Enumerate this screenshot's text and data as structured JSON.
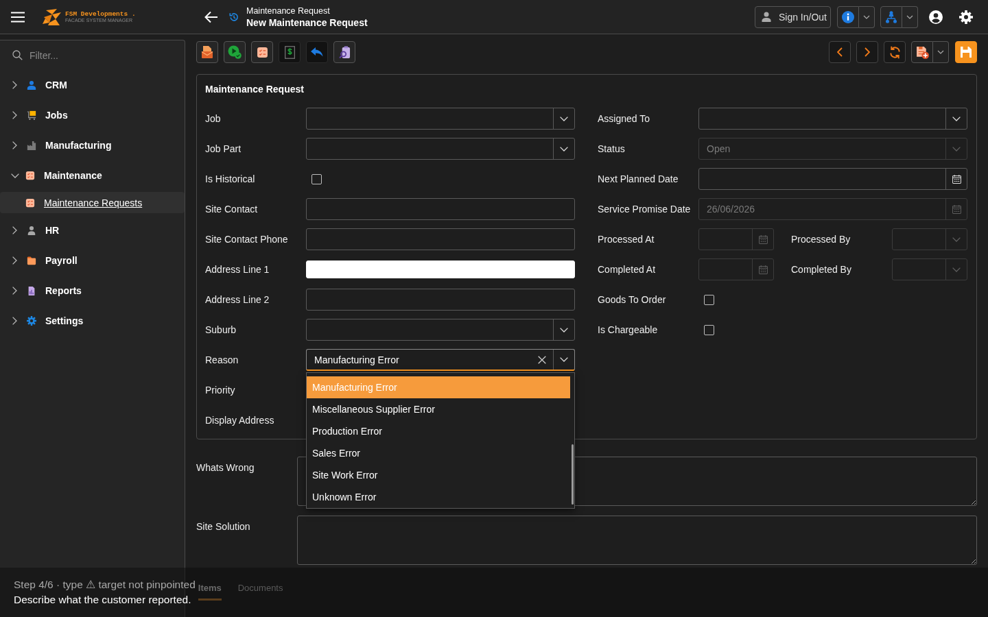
{
  "app_bar": {
    "logo_name": "FSM Developments .",
    "logo_tagline": "FACADE SYSTEM MANAGER",
    "breadcrumb": "Maintenance Request",
    "title": "New Maintenance Request",
    "sign_in_button": "Sign In/Out"
  },
  "sidebar": {
    "filter_placeholder": "Filter...",
    "items": [
      {
        "label": "CRM",
        "expanded": false
      },
      {
        "label": "Jobs",
        "expanded": false
      },
      {
        "label": "Manufacturing",
        "expanded": false
      },
      {
        "label": "Maintenance",
        "expanded": true,
        "children": [
          {
            "label": "Maintenance Requests",
            "selected": true
          }
        ]
      },
      {
        "label": "HR",
        "expanded": false
      },
      {
        "label": "Payroll",
        "expanded": false
      },
      {
        "label": "Reports",
        "expanded": false
      },
      {
        "label": "Settings",
        "expanded": false
      }
    ]
  },
  "form": {
    "title": "Maintenance Request",
    "left_fields": [
      {
        "label": "Job",
        "kind": "select",
        "disabled": false,
        "open": false
      },
      {
        "label": "Job Part",
        "kind": "select",
        "disabled": false,
        "open": false
      },
      {
        "label": "Is Historical",
        "kind": "checkbox",
        "checked": false
      },
      {
        "label": "Site Contact",
        "kind": "text",
        "disabled": false,
        "autofilled": false
      },
      {
        "label": "Site Contact Phone",
        "kind": "text",
        "disabled": false,
        "autofilled": false
      },
      {
        "label": "Address Line 1",
        "kind": "text",
        "disabled": false,
        "autofilled": true
      },
      {
        "label": "Address Line 2",
        "kind": "text",
        "disabled": false,
        "autofilled": false
      },
      {
        "label": "Suburb",
        "kind": "select",
        "disabled": false,
        "open": false
      },
      {
        "label": "Reason",
        "kind": "select",
        "disabled": false,
        "open": true,
        "value": "Manufacturing Error",
        "options": [
          {
            "label": "Manufacturing Error",
            "selected": true
          },
          {
            "label": "Miscellaneous Supplier Error",
            "selected": false
          },
          {
            "label": "Production Error",
            "selected": false
          },
          {
            "label": "Sales Error",
            "selected": false
          },
          {
            "label": "Site Work Error",
            "selected": false
          },
          {
            "label": "Unknown Error",
            "selected": false
          }
        ]
      },
      {
        "label": "Priority",
        "kind": "label"
      },
      {
        "label": "Display Address",
        "kind": "label"
      }
    ],
    "right_fields": [
      {
        "label": "Assigned To",
        "kind": "select",
        "disabled": false,
        "open": false
      },
      {
        "label": "Status",
        "kind": "select",
        "disabled": true,
        "open": false,
        "value": "Open"
      },
      {
        "label": "Next Planned Date",
        "kind": "date",
        "disabled": false
      },
      {
        "label": "Service Promise Date",
        "kind": "date",
        "disabled": true,
        "value": "26/06/2026"
      },
      {
        "kind": "pair",
        "fields": [
          {
            "label": "Processed At",
            "kind": "date",
            "disabled": true
          },
          {
            "label": "Processed By",
            "kind": "select",
            "disabled": true,
            "open": false
          }
        ]
      },
      {
        "kind": "pair",
        "fields": [
          {
            "label": "Completed At",
            "kind": "date",
            "disabled": true
          },
          {
            "label": "Completed By",
            "kind": "select",
            "disabled": true,
            "open": false
          }
        ]
      },
      {
        "label": "Goods To Order",
        "kind": "checkbox",
        "checked": false
      },
      {
        "label": "Is Chargeable",
        "kind": "checkbox",
        "checked": false
      }
    ]
  },
  "notes": [
    {
      "label": "Whats Wrong"
    },
    {
      "label": "Site Solution"
    }
  ],
  "tabs": [
    {
      "label": "Items",
      "selected": true
    },
    {
      "label": "Documents",
      "selected": false
    }
  ],
  "guide": {
    "step": "Step 4/6 · type ⚠ target not pinpointed",
    "instruction": "Describe what the customer reported."
  }
}
